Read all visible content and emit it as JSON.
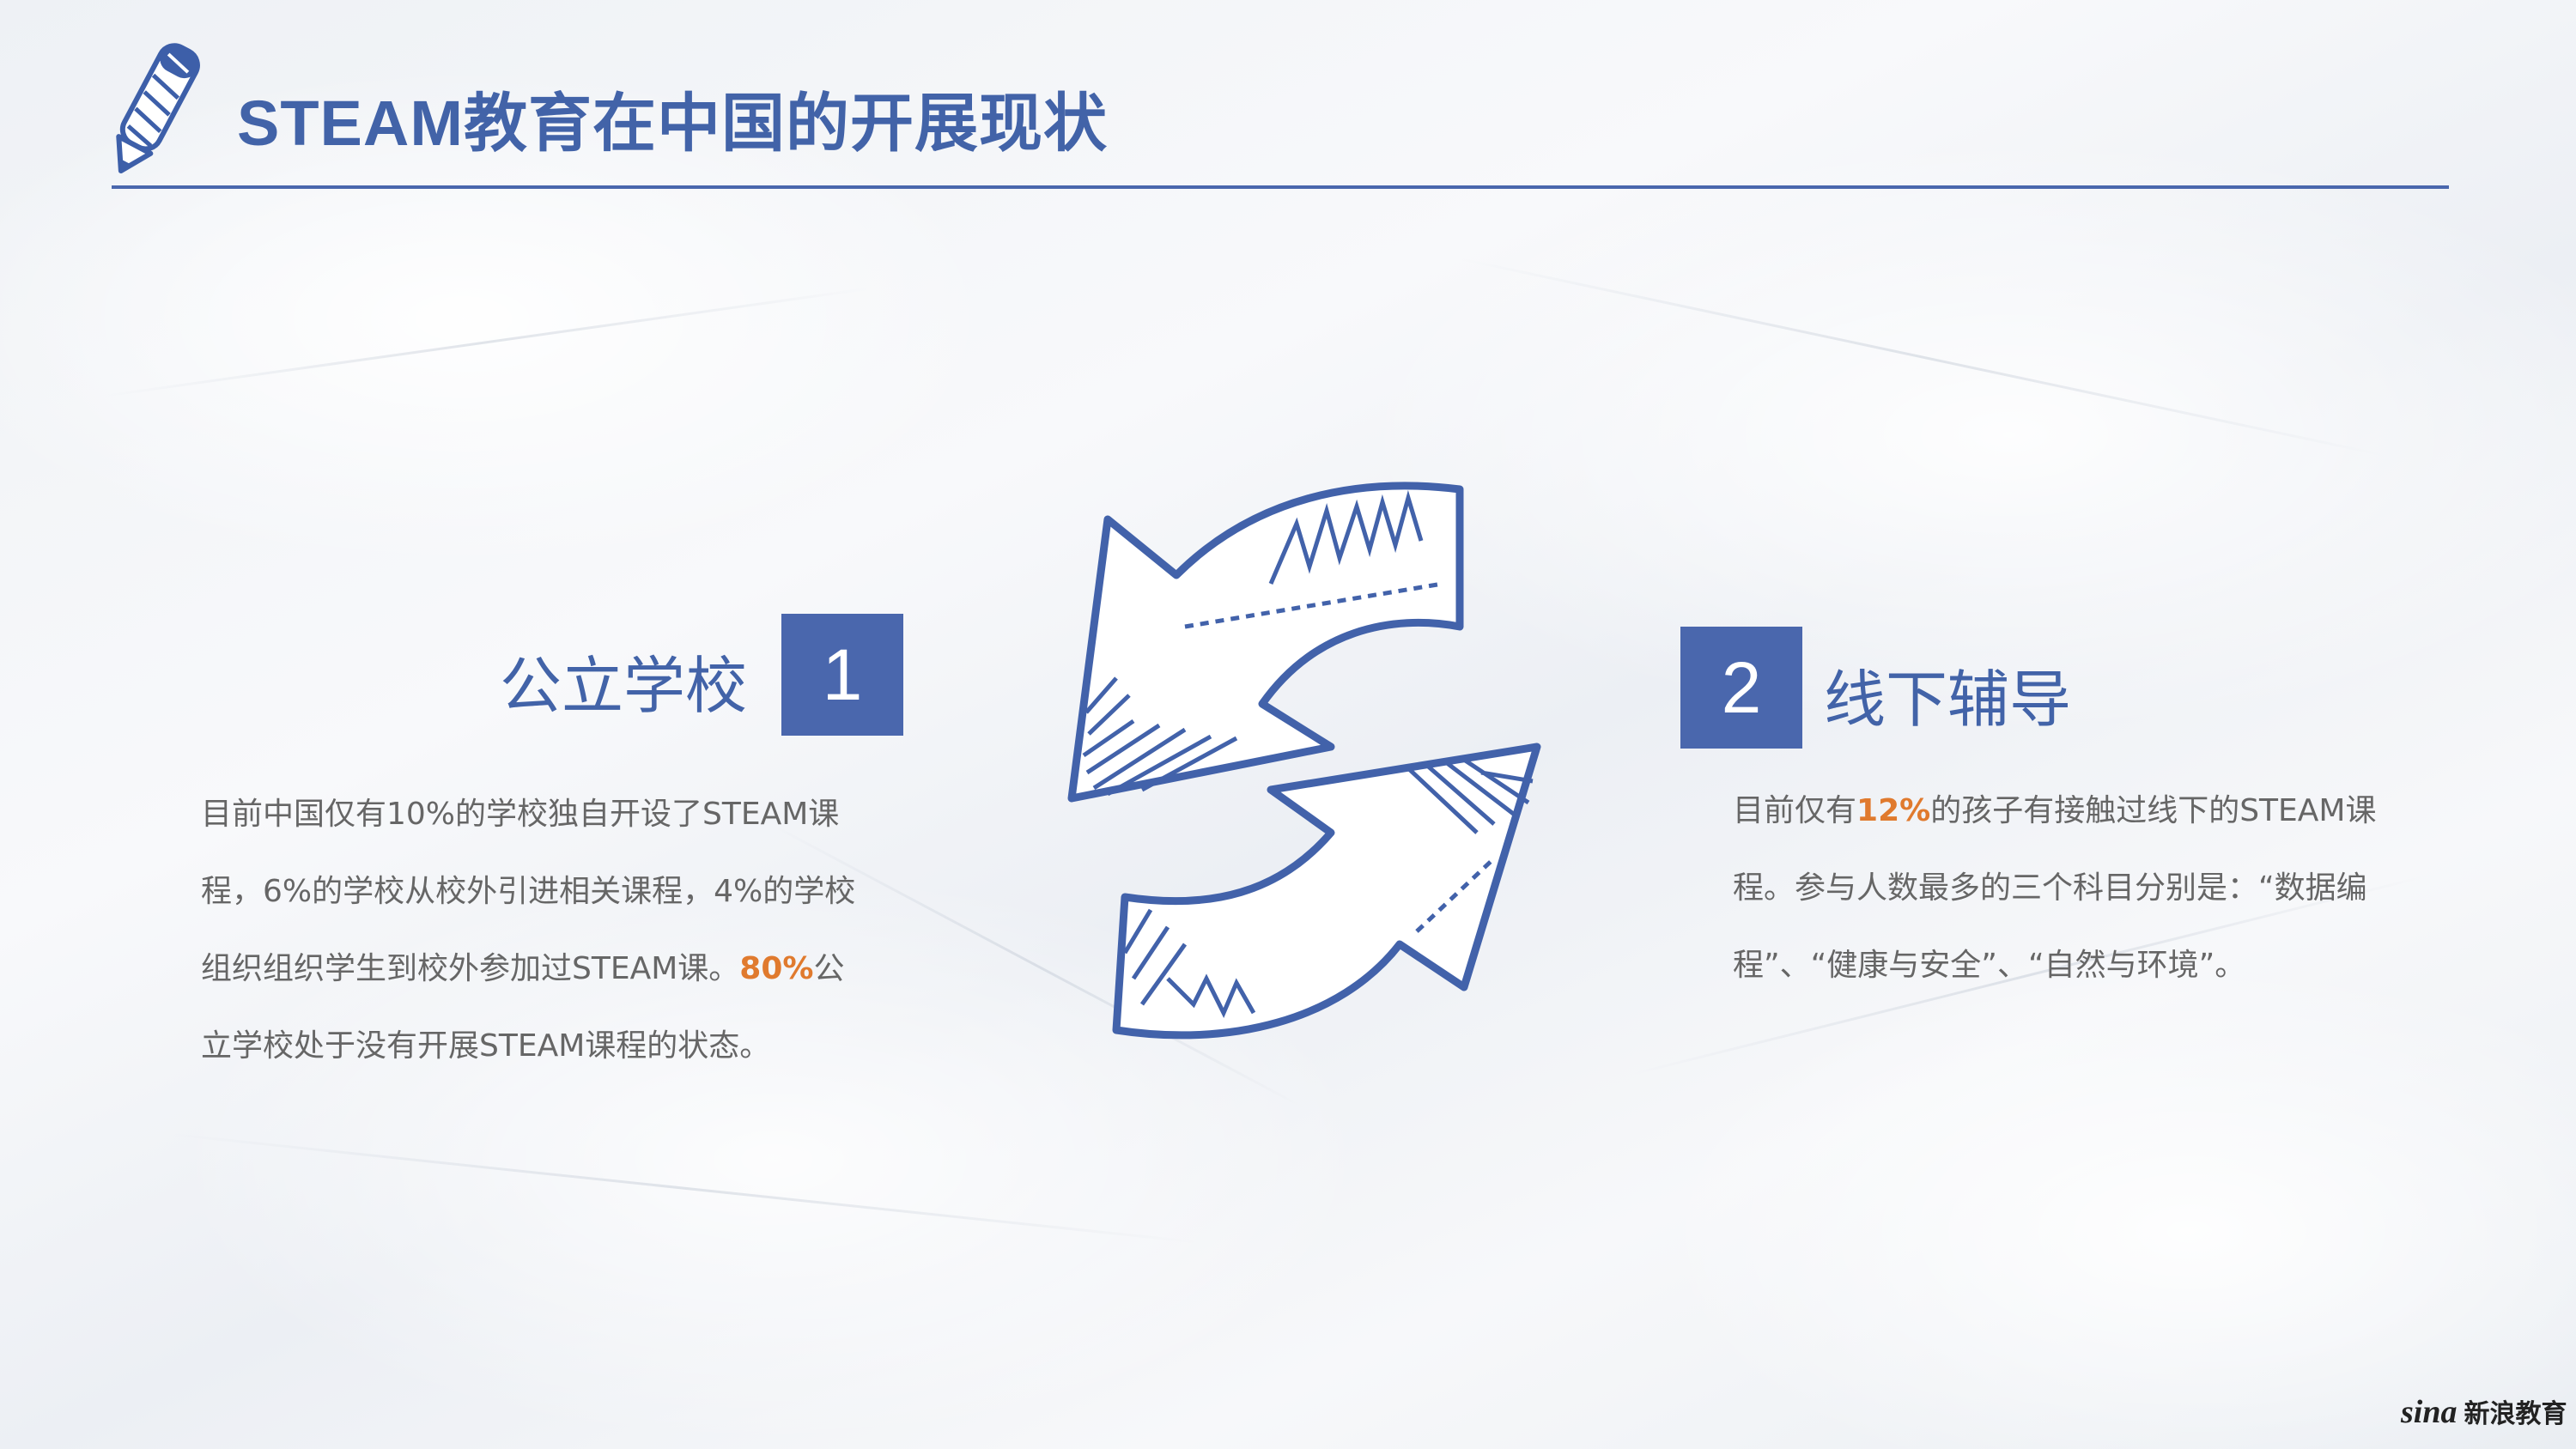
{
  "header": {
    "title": "STEAM教育在中国的开展现状",
    "icon": "pencil-icon"
  },
  "left_section": {
    "heading": "公立学校",
    "number": "1",
    "text_part1": "目前中国仅有10%的学校独自开设了STEAM课程，6%的学校从校外引进相关课程，4%的学校组织组织学生到校外参加过STEAM课。",
    "highlight": "80%",
    "text_part2": "公立学校处于没有开展STEAM课程的状态。"
  },
  "right_section": {
    "number": "2",
    "heading": "线下辅导",
    "text_part1": "目前仅有",
    "highlight": "12%",
    "text_part2": "的孩子有接触过线下的STEAM课程。参与人数最多的三个科目分别是：“数据编程”、“健康与安全”、“自然与环境”。"
  },
  "center_graphic": {
    "icon": "cycle-arrows-icon"
  },
  "footer": {
    "logo_latin": "sina",
    "logo_cn": "新浪教育"
  },
  "colors": {
    "primary": "#4a67ad",
    "title": "#4263a8",
    "highlight": "#e07a2e",
    "body": "#666666"
  }
}
